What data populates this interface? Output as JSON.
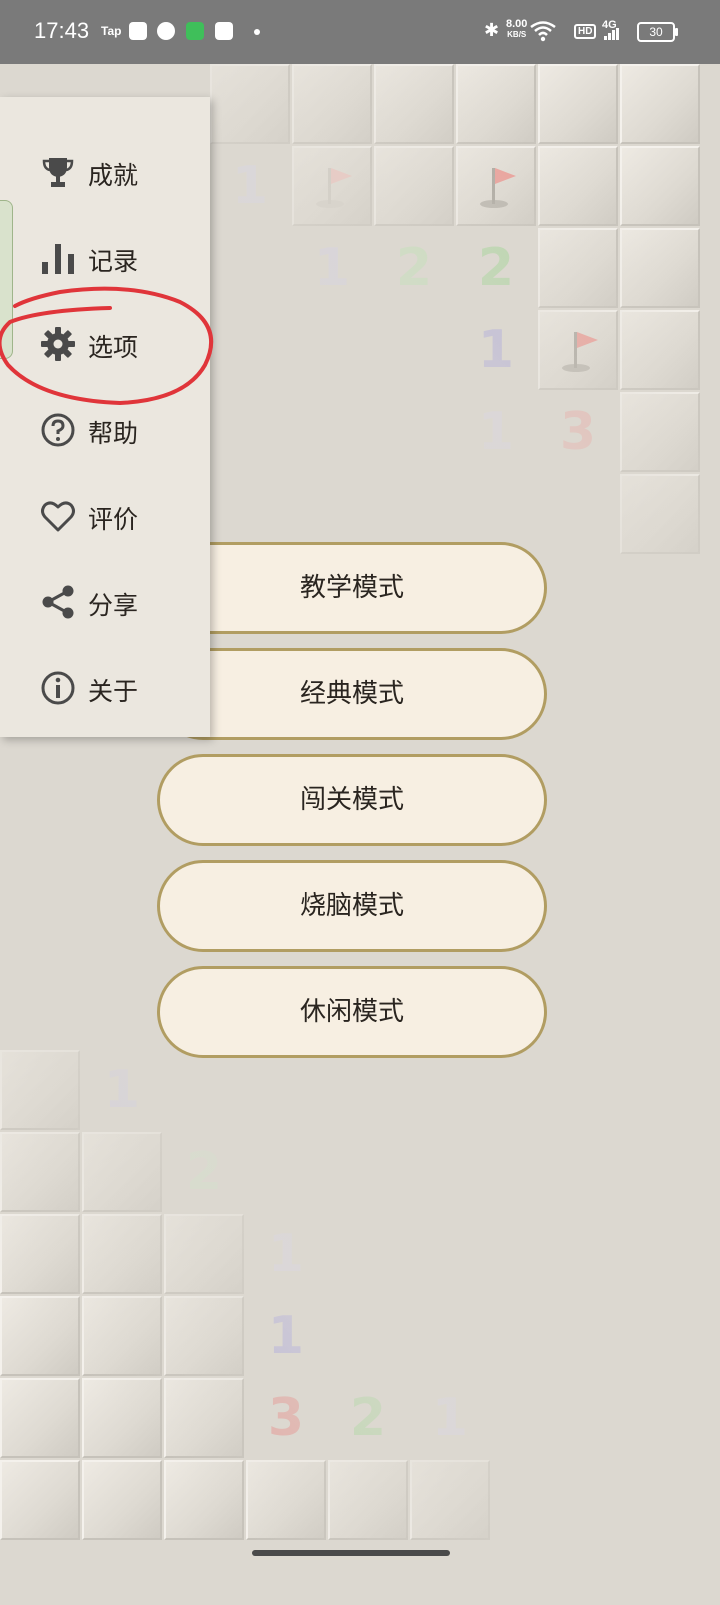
{
  "status_bar": {
    "time": "17:43",
    "tap_label": "Tap",
    "net_speed_value": "8.00",
    "net_speed_unit": "KB/S",
    "hd_label": "HD",
    "network_label": "4G",
    "battery": "30"
  },
  "drawer": {
    "items": [
      {
        "label": "成就",
        "icon": "trophy-icon"
      },
      {
        "label": "记录",
        "icon": "bar-chart-icon"
      },
      {
        "label": "选项",
        "icon": "gear-icon"
      },
      {
        "label": "帮助",
        "icon": "help-circle-icon"
      },
      {
        "label": "评价",
        "icon": "heart-icon"
      },
      {
        "label": "分享",
        "icon": "share-icon"
      },
      {
        "label": "关于",
        "icon": "info-icon"
      }
    ]
  },
  "modes": {
    "tutorial": "教学模式",
    "classic": "经典模式",
    "levels": "闯关模式",
    "puzzle": "烧脑模式",
    "casual": "休闲模式"
  },
  "board_numbers": {
    "top": [
      "1",
      "1",
      "2",
      "2",
      "1",
      "1",
      "3"
    ],
    "bottom": [
      "1",
      "2",
      "1",
      "1",
      "3",
      "2",
      "1"
    ]
  },
  "colors": {
    "num_1": "#b7b3da",
    "num_2": "#b4d6a8",
    "num_3": "#e6a9a4",
    "button_border": "#b19d62",
    "button_fill": "#f7efe2",
    "annotation": "#e0353a"
  }
}
